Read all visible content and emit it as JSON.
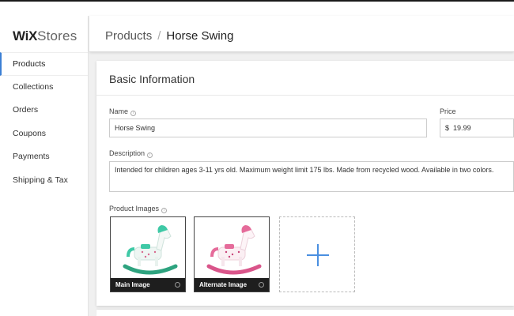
{
  "brand": {
    "bold": "WiX",
    "rest": "Stores"
  },
  "sidebar": {
    "items": [
      {
        "label": "Products"
      },
      {
        "label": "Collections"
      },
      {
        "label": "Orders"
      },
      {
        "label": "Coupons"
      },
      {
        "label": "Payments"
      },
      {
        "label": "Shipping & Tax"
      }
    ]
  },
  "breadcrumb": {
    "parent": "Products",
    "separator": "/",
    "current": "Horse Swing"
  },
  "card": {
    "title": "Basic Information",
    "name": {
      "label": "Name",
      "value": "Horse Swing"
    },
    "price": {
      "label": "Price",
      "currency": "$",
      "value": "19.99"
    },
    "description": {
      "label": "Description",
      "value": "Intended for children ages 3-11 yrs old. Maximum weight limit 175 lbs. Made from recycled wood. Available in two colors."
    },
    "images": {
      "label": "Product Images",
      "main": {
        "caption": "Main Image",
        "color": "#3fc9a6"
      },
      "alternate": {
        "caption": "Alternate Image",
        "color": "#e56b9a"
      }
    }
  },
  "colors": {
    "accent": "#3b7fd4",
    "plus": "#4a8fe0"
  }
}
